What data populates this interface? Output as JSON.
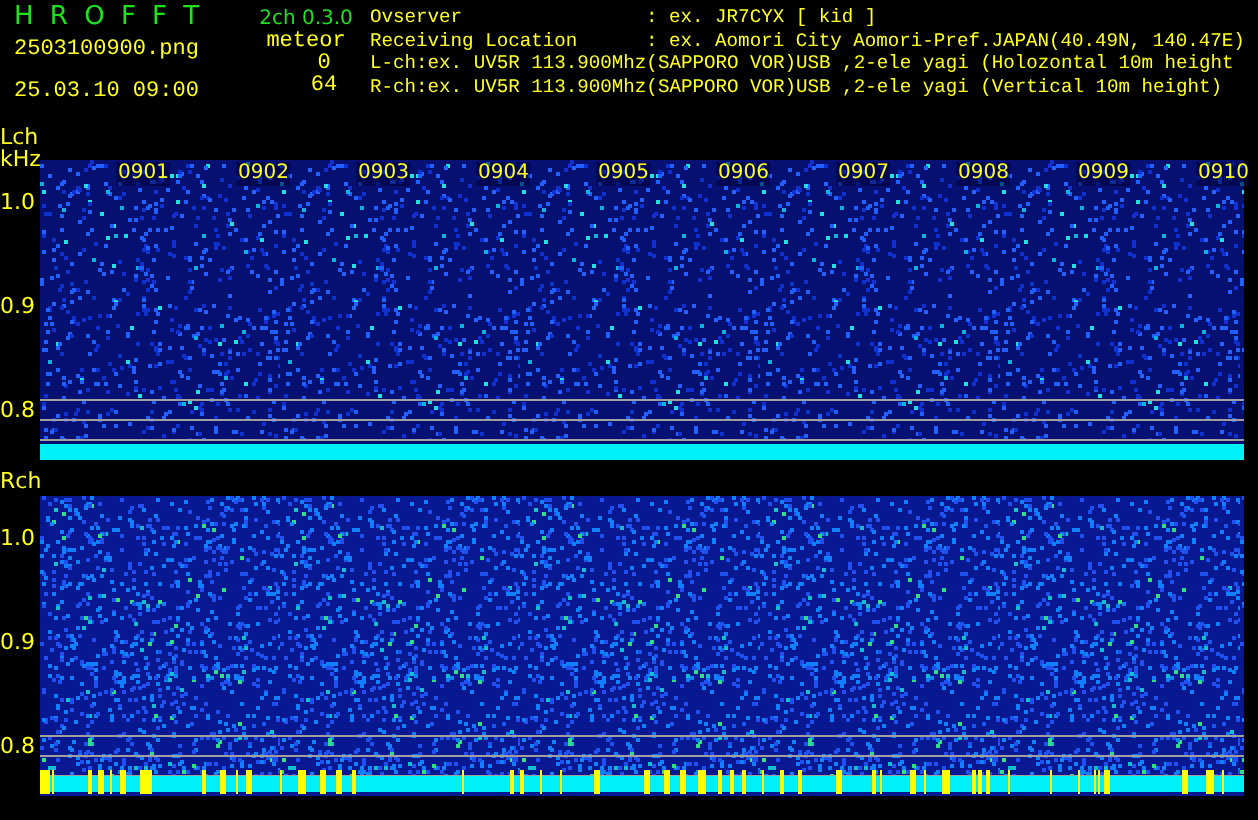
{
  "header": {
    "title": "H R O F F T",
    "version": "2ch 0.3.0",
    "filename": "2503100900.png",
    "datetime": "25.03.10 09:00",
    "meteor_label": "meteor",
    "counts": [
      "0",
      "64"
    ]
  },
  "info": [
    {
      "label": "Ovserver",
      "value": ": ex. JR7CYX [ kid ]"
    },
    {
      "label": "Receiving Location",
      "value": ": ex. Aomori City Aomori-Pref.JAPAN(40.49N, 140.47E)"
    },
    {
      "label": "L-ch:",
      "value": "ex. UV5R 113.900Mhz(SAPPORO VOR)USB ,2-ele yagi (Holozontal 10m height"
    },
    {
      "label": "R-ch:",
      "value": "ex. UV5R 113.900Mhz(SAPPORO VOR)USB ,2-ele yagi (Vertical 10m height)"
    }
  ],
  "channels": [
    {
      "label": "Lch",
      "unit": "kHz",
      "y_labels": [
        "1.0",
        "0.9",
        "0.8"
      ],
      "time_labels": [
        "0901",
        "0902",
        "0903",
        "0904",
        "0905",
        "0906",
        "0907",
        "0908",
        "0909",
        "0910"
      ]
    },
    {
      "label": "Rch",
      "y_labels": [
        "1.0",
        "0.9",
        "0.8"
      ]
    }
  ]
}
